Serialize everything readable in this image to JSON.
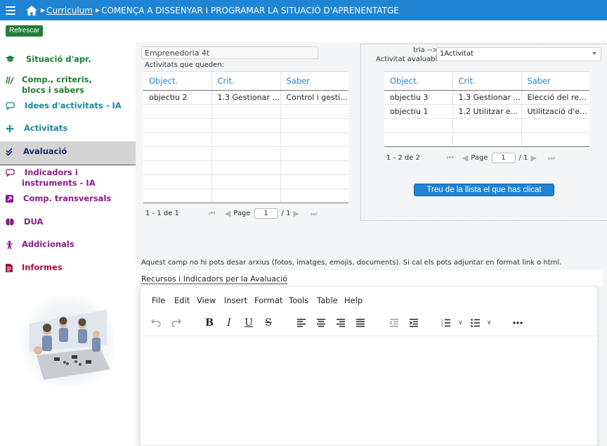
{
  "header": {
    "breadcrumb_link": "Curriculum",
    "breadcrumb_current": "COMENÇA A DISSENYAR I PROGRAMAR LA SITUACIÓ D'APRENENTATGE"
  },
  "refresh_label": "Refrescar",
  "sidebar": {
    "items": [
      {
        "label": "Situació d'apr.",
        "icon": "graduation-cap-icon"
      },
      {
        "label": "Comp., criteris,",
        "label2": "blocs i sabers",
        "icon": "books-icon"
      },
      {
        "label": "Idees d'activitats - IA",
        "icon": "chat-bubble-icon"
      },
      {
        "label": "Activitats",
        "icon": "move-arrows-icon"
      },
      {
        "label": "Avaluació",
        "icon": "check-double-icon"
      },
      {
        "label": "Indicadors i",
        "label2": "instruments - IA",
        "icon": "chat-bubble-icon"
      },
      {
        "label": "Comp. transversals",
        "icon": "arrow-box-icon"
      },
      {
        "label": "DUA",
        "icon": "brain-icon"
      },
      {
        "label": "Addicionals",
        "icon": "person-icon"
      },
      {
        "label": "Informes",
        "icon": "document-icon"
      }
    ]
  },
  "left": {
    "project_name": "Emprenedoria 4t",
    "remaining_label": "Activitats que queden:",
    "columns": [
      "Object.",
      "Crit.",
      "Saber"
    ],
    "rows": [
      [
        "objectiu 2",
        "1.3 Gestionar ...",
        "Control i gesti..."
      ]
    ],
    "range": "1 - 1 de 1",
    "page_label": "Page",
    "page": "1",
    "of_pages": "/ 1"
  },
  "right": {
    "choose_label": "tria -->",
    "activity_label": "Activitat avaluable",
    "selected_activity": "1Activitat",
    "columns": [
      "Object.",
      "Crit.",
      "Saber"
    ],
    "rows": [
      [
        "objectiu 3",
        "1.3 Gestionar ...",
        "Elecció del rep..."
      ],
      [
        "objectiu 1",
        "1.2 Utilitzar es...",
        "Utilització d'es..."
      ]
    ],
    "range": "1 - 2 de 2",
    "page_label": "Page",
    "page": "1",
    "of_pages": "/ 1",
    "remove_button": "Treu de la llista el que has clicat"
  },
  "notice": "Aquest camp no hi pots desar arxius (fotos, imatges, emojis, documents). Si cal els pots adjuntar en format link o html.",
  "field_label": "Recursos i Indicadors per la Avaluació",
  "editor": {
    "menu": [
      "File",
      "Edit",
      "View",
      "Insert",
      "Format",
      "Tools",
      "Table",
      "Help"
    ]
  },
  "colors": {
    "header_blue": "#1f84d3",
    "refresh_green": "#1e7e34",
    "green_item": "#1e7e34",
    "teal_item": "#1a8a9a",
    "navy_item": "#1a2a6c",
    "purple_item": "#8b1a8b",
    "crimson_item": "#a3123a"
  }
}
